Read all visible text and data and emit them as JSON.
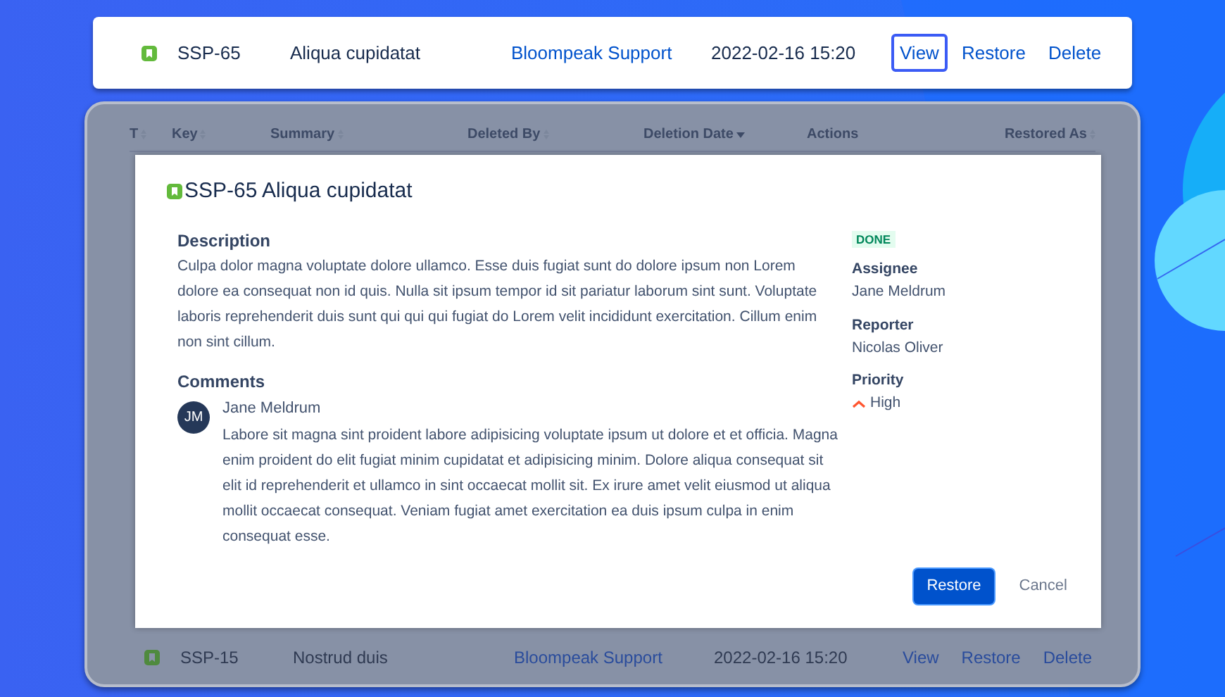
{
  "top_row": {
    "key": "SSP-65",
    "summary": "Aliqua cupidatat",
    "deleted_by": "Bloompeak Support",
    "deletion_date": "2022-02-16 15:20",
    "actions": [
      {
        "label": "View",
        "focused": true
      },
      {
        "label": "Restore",
        "focused": false
      },
      {
        "label": "Delete",
        "focused": false
      }
    ]
  },
  "table": {
    "columns": [
      {
        "label": "T",
        "sorted": false
      },
      {
        "label": "Key",
        "sorted": false
      },
      {
        "label": "Summary",
        "sorted": false
      },
      {
        "label": "Deleted By",
        "sorted": false
      },
      {
        "label": "Deletion Date",
        "sorted": true
      },
      {
        "label": "Actions"
      },
      {
        "label": "Restored As",
        "sorted": false
      }
    ],
    "rows": [
      {
        "key": "SSP-15",
        "summary": "Nostrud duis",
        "deleted_by": "Bloompeak Support",
        "deletion_date": "2022-02-16 15:20",
        "actions": [
          {
            "label": "View",
            "focused": false
          },
          {
            "label": "Restore",
            "focused": false
          },
          {
            "label": "Delete",
            "focused": false
          }
        ]
      }
    ]
  },
  "dialog": {
    "title": "SSP-65 Aliqua cupidatat",
    "description_heading": "Description",
    "description": "Culpa dolor magna voluptate dolore ullamco. Esse duis fugiat sunt do dolore ipsum non Lorem dolore ea consequat non id quis. Nulla sit ipsum tempor id sit pariatur laborum sint sunt. Voluptate laboris reprehenderit duis sunt qui qui qui fugiat do Lorem velit incididunt exercitation. Cillum enim non sint cillum.",
    "comments_heading": "Comments",
    "comments": [
      {
        "initials": "JM",
        "author": "Jane Meldrum",
        "text": "Labore sit magna sint proident labore adipisicing voluptate ipsum ut dolore et et officia. Magna enim proident do elit fugiat minim cupidatat et adipisicing minim. Dolore aliqua consequat sit elit id reprehenderit et ullamco in sint occaecat mollit sit. Ex irure amet velit eiusmod ut aliqua mollit occaecat consequat. Veniam fugiat amet exercitation ea duis ipsum culpa in enim consequat esse."
      }
    ],
    "status": "DONE",
    "fields": [
      {
        "label": "Assignee",
        "value": "Jane Meldrum",
        "kind": "text"
      },
      {
        "label": "Reporter",
        "value": "Nicolas Oliver",
        "kind": "text"
      },
      {
        "label": "Priority",
        "value": "High",
        "kind": "priority"
      }
    ],
    "buttons": [
      {
        "label": "Restore",
        "kind": "primary"
      },
      {
        "label": "Cancel",
        "kind": "subtle"
      }
    ]
  }
}
